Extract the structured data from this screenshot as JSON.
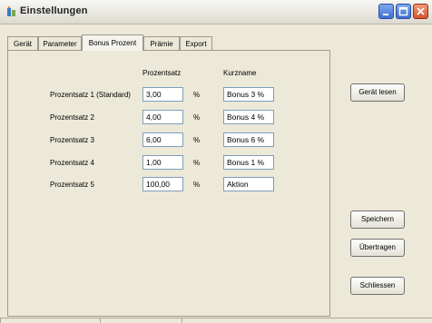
{
  "window": {
    "title": "Einstellungen"
  },
  "tabs": [
    {
      "label": "Gerät"
    },
    {
      "label": "Parameter"
    },
    {
      "label": "Bonus Prozent"
    },
    {
      "label": "Prämie"
    },
    {
      "label": "Export"
    }
  ],
  "columns": {
    "percent": "Prozentsatz",
    "shortname": "Kurzname"
  },
  "rows": [
    {
      "label": "Prozentsatz 1 (Standard)",
      "value": "3,00",
      "unit": "%",
      "name": "Bonus 3 %"
    },
    {
      "label": "Prozentsatz 2",
      "value": "4,00",
      "unit": "%",
      "name": "Bonus 4 %"
    },
    {
      "label": "Prozentsatz 3",
      "value": "6,00",
      "unit": "%",
      "name": "Bonus 6 %"
    },
    {
      "label": "Prozentsatz 4",
      "value": "1,00",
      "unit": "%",
      "name": "Bonus 1 %"
    },
    {
      "label": "Prozentsatz 5",
      "value": "100,00",
      "unit": "%",
      "name": "Aktion"
    }
  ],
  "buttons": {
    "read": "Gerät lesen",
    "save": "Speichern",
    "transfer": "Übertragen",
    "close": "Schliessen"
  },
  "icons": {
    "app": "app-icon",
    "minimize": "minimize-icon",
    "maximize": "maximize-icon",
    "close": "close-icon"
  }
}
